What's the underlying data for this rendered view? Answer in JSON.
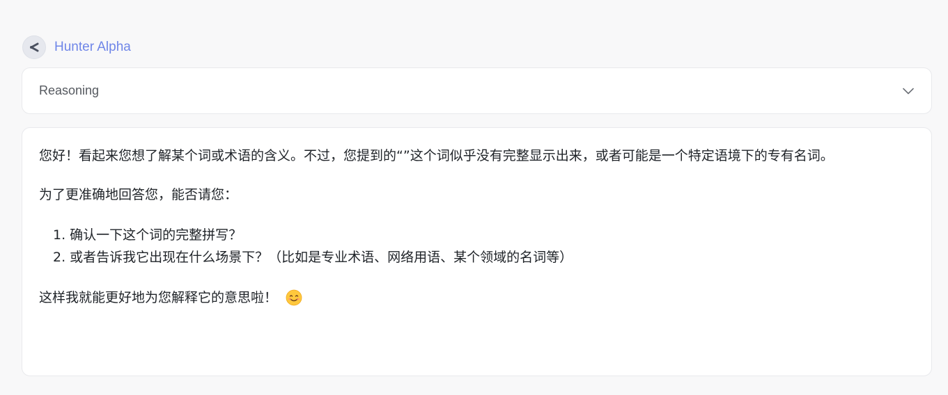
{
  "model": {
    "name": "Hunter Alpha",
    "avatar_icon": "model-logo-icon"
  },
  "reasoning": {
    "label": "Reasoning",
    "toggle_icon": "chevron-down-icon"
  },
  "answer": {
    "paragraph1": "您好！看起来您想了解某个词或术语的含义。不过，您提到的“”这个词似乎没有完整显示出来，或者可能是一个特定语境下的专有名词。",
    "paragraph2": "为了更准确地回答您，能否请您：",
    "list": [
      "1. 确认一下这个词的完整拼写？",
      "2. 或者告诉我它出现在什么场景下？（比如是专业术语、网络用语、某个领域的名词等）"
    ],
    "paragraph3": "这样我就能更好地为您解释它的意思啦！",
    "emoji_icon": "smiling-face-icon"
  },
  "colors": {
    "accent": "#6f86e8",
    "background": "#f8f8f9",
    "card": "#ffffff",
    "border": "#e8e9ec"
  }
}
